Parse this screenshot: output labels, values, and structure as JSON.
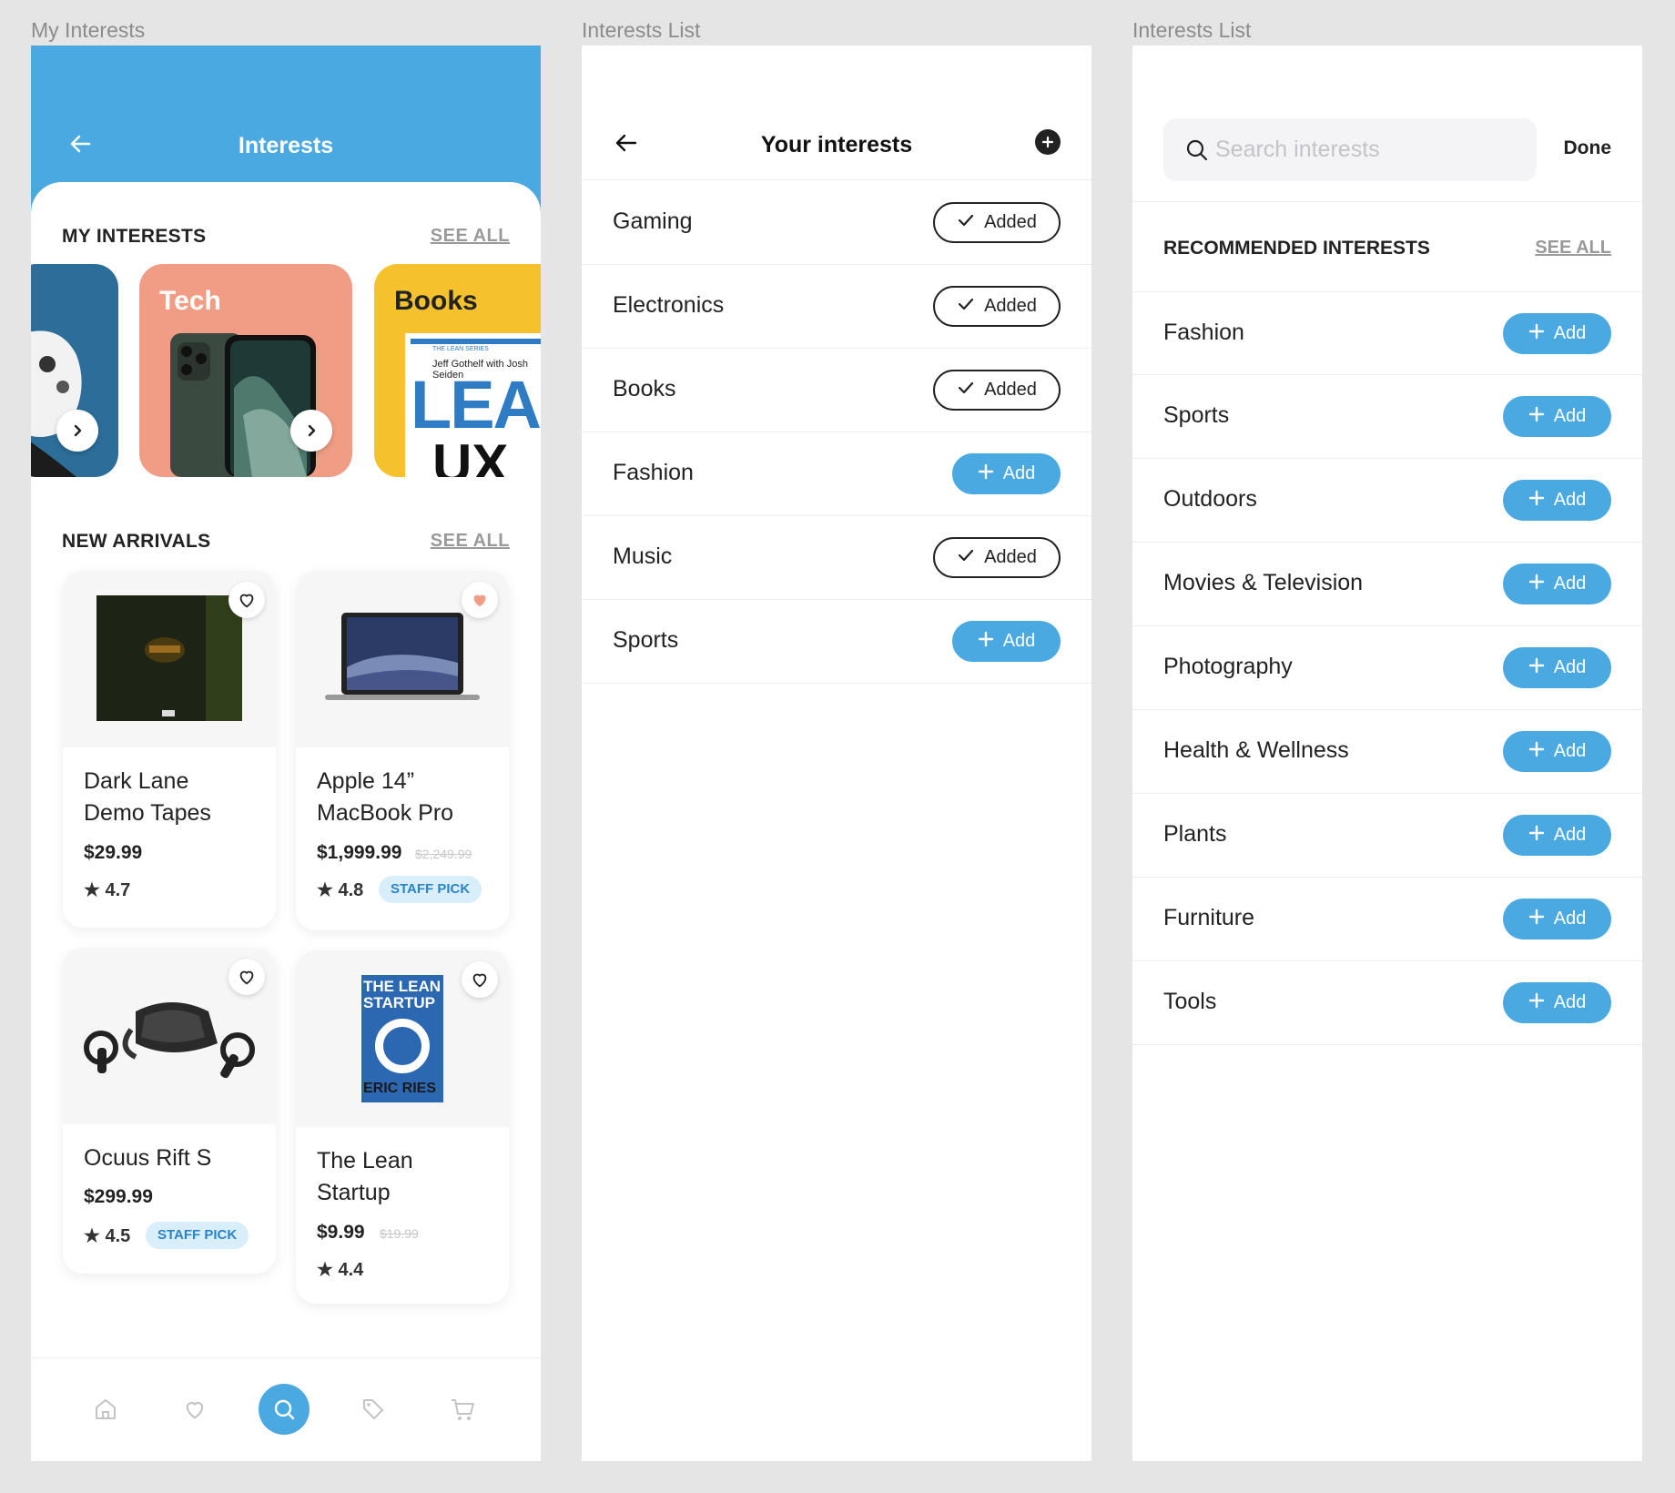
{
  "frames": {
    "my_interests": "My Interests",
    "interests_list_1": "Interests List",
    "interests_list_2": "Interests List"
  },
  "screen1": {
    "title": "Interests",
    "my_interests": {
      "heading": "MY INTERESTS",
      "see_all": "SEE ALL"
    },
    "categories": [
      {
        "label": "",
        "color": "#2c6e99"
      },
      {
        "label": "Tech",
        "color": "#f19d85"
      },
      {
        "label": "Books",
        "color": "#f5c22d"
      }
    ],
    "book_cover": {
      "series": "THE LEAN SERIES",
      "authors": "Jeff Gothelf with Josh Seiden",
      "title_top": "LEAN",
      "title_bottom": "UX"
    },
    "new_arrivals": {
      "heading": "NEW ARRIVALS",
      "see_all": "SEE ALL"
    },
    "products": [
      {
        "name_line1": "Dark Lane",
        "name_line2": "Demo Tapes",
        "price": "$29.99",
        "old_price": "",
        "rating": "4.7",
        "badge": "",
        "favorited": false
      },
      {
        "name_line1": "Apple 14”",
        "name_line2": "MacBook Pro",
        "price": "$1,999.99",
        "old_price": "$2,249.99",
        "rating": "4.8",
        "badge": "STAFF PICK",
        "favorited": true
      },
      {
        "name_line1": "Ocuus Rift S",
        "name_line2": "",
        "price": "$299.99",
        "old_price": "",
        "rating": "4.5",
        "badge": "STAFF PICK",
        "favorited": false
      },
      {
        "name_line1": "The Lean",
        "name_line2": "Startup",
        "price": "$9.99",
        "old_price": "$19.99",
        "rating": "4.4",
        "badge": "",
        "favorited": false
      }
    ],
    "lean_startup_cover": {
      "title_line1": "THE LEAN",
      "title_line2": "STARTUP",
      "author": "ERIC RIES"
    },
    "tabbar": [
      "home-icon",
      "heart-icon",
      "search-icon",
      "tag-icon",
      "cart-icon"
    ],
    "accent": "#4ba9e2"
  },
  "screen2": {
    "title": "Your interests",
    "items": [
      {
        "label": "Gaming",
        "state": "added",
        "button": "Added"
      },
      {
        "label": "Electronics",
        "state": "added",
        "button": "Added"
      },
      {
        "label": "Books",
        "state": "added",
        "button": "Added"
      },
      {
        "label": "Fashion",
        "state": "add",
        "button": "Add"
      },
      {
        "label": "Music",
        "state": "added",
        "button": "Added"
      },
      {
        "label": "Sports",
        "state": "add",
        "button": "Add"
      }
    ]
  },
  "screen3": {
    "search_placeholder": "Search interests",
    "search_value": "",
    "done": "Done",
    "heading": "RECOMMENDED INTERESTS",
    "see_all": "SEE ALL",
    "items": [
      {
        "label": "Fashion",
        "button": "Add"
      },
      {
        "label": "Sports",
        "button": "Add"
      },
      {
        "label": "Outdoors",
        "button": "Add"
      },
      {
        "label": "Movies & Television",
        "button": "Add"
      },
      {
        "label": "Photography",
        "button": "Add"
      },
      {
        "label": "Health & Wellness",
        "button": "Add"
      },
      {
        "label": "Plants",
        "button": "Add"
      },
      {
        "label": "Furniture",
        "button": "Add"
      },
      {
        "label": "Tools",
        "button": "Add"
      }
    ]
  }
}
